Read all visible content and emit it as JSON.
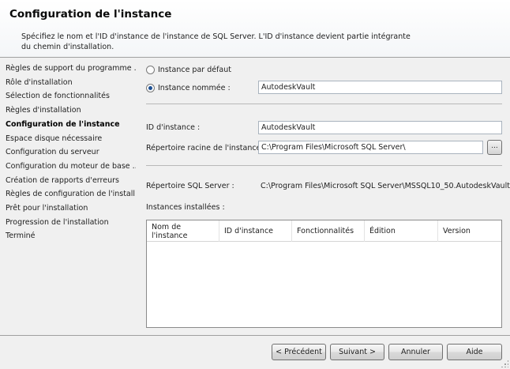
{
  "header": {
    "title": "Configuration de l'instance",
    "description": "Spécifiez le nom et l'ID d'instance de l'instance de SQL Server. L'ID d'instance devient partie intégrante du chemin d'installation."
  },
  "nav": {
    "items": [
      {
        "label": "Règles de support du programme ..."
      },
      {
        "label": "Rôle d'installation"
      },
      {
        "label": "Sélection de fonctionnalités"
      },
      {
        "label": "Règles d'installation"
      },
      {
        "label": "Configuration de l'instance",
        "active": true
      },
      {
        "label": "Espace disque nécessaire"
      },
      {
        "label": "Configuration du serveur"
      },
      {
        "label": "Configuration du moteur de base ..."
      },
      {
        "label": "Création de rapports d'erreurs"
      },
      {
        "label": "Règles de configuration de l'install..."
      },
      {
        "label": "Prêt pour l'installation"
      },
      {
        "label": "Progression de l'installation"
      },
      {
        "label": "Terminé"
      }
    ]
  },
  "form": {
    "default_instance_label": "Instance par défaut",
    "default_instance_selected": false,
    "named_instance_label": "Instance nommée :",
    "named_instance_selected": true,
    "named_instance_value": "AutodeskVault",
    "instance_id_label": "ID d'instance :",
    "instance_id_value": "AutodeskVault",
    "root_dir_label": "Répertoire racine de l'instance :",
    "root_dir_value": "C:\\Program Files\\Microsoft SQL Server\\",
    "browse_label": "...",
    "sql_dir_label": "Répertoire SQL Server :",
    "sql_dir_value": "C:\\Program Files\\Microsoft SQL Server\\MSSQL10_50.AutodeskVault",
    "installed_instances_label": "Instances installées :"
  },
  "grid": {
    "columns": [
      "Nom de l'instance",
      "ID d'instance",
      "Fonctionnalités",
      "Édition",
      "Version"
    ],
    "rows": []
  },
  "footer": {
    "prev_label": "< Précédent",
    "next_label": "Suivant >",
    "cancel_label": "Annuler",
    "help_label": "Aide"
  }
}
